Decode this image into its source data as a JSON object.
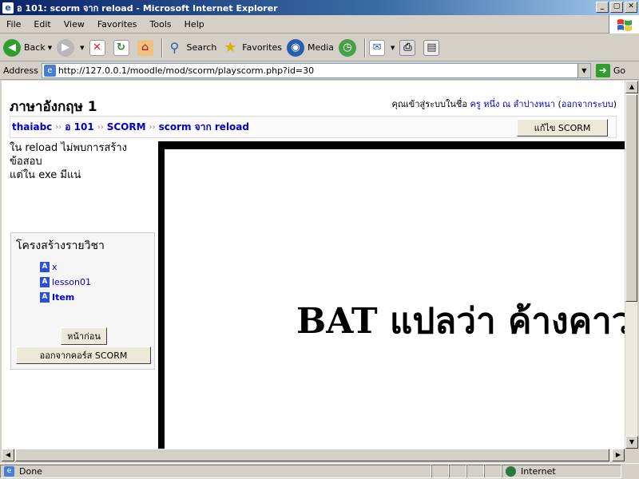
{
  "window": {
    "title": "อ 101: scorm จาก reload - Microsoft Internet Explorer",
    "min_glyph": "_",
    "max_glyph": "▢",
    "close_glyph": "✕"
  },
  "menu": [
    "File",
    "Edit",
    "View",
    "Favorites",
    "Tools",
    "Help"
  ],
  "toolbar": {
    "back": "Back",
    "search": "Search",
    "favorites": "Favorites",
    "media": "Media"
  },
  "address": {
    "label": "Address",
    "url": "http://127.0.0.1/moodle/mod/scorm/playscorm.php?id=30",
    "go": "Go"
  },
  "page": {
    "course_title": "ภาษาอังกฤษ 1",
    "login_prefix": "คุณเข้าสู่ระบบในชื่อ ",
    "user_name": "ครู หนึ่ง ณ ลำปางหนา",
    "logout_label": "ออกจากระบบ",
    "breadcrumb": [
      "thaiabc",
      "อ 101",
      "SCORM",
      "scorm จาก reload"
    ],
    "breadcrumb_sep": "››",
    "edit_button": "แก้ไข SCORM",
    "note_lines": [
      "ใน reload ไม่พบการสร้าง",
      "ข้อสอบ",
      "แต่ใน exe มีแน่"
    ],
    "toc_title": "โครงสร้างรายวิชา",
    "toc_items": [
      "x",
      "lesson01",
      "Item"
    ],
    "prev_button": "หน้าก่อน",
    "exit_button": "ออกจากคอร์ส SCORM",
    "content_text": "BAT แปลว่า ค้างคาว"
  },
  "status": {
    "text": "Done",
    "zone": "Internet"
  }
}
